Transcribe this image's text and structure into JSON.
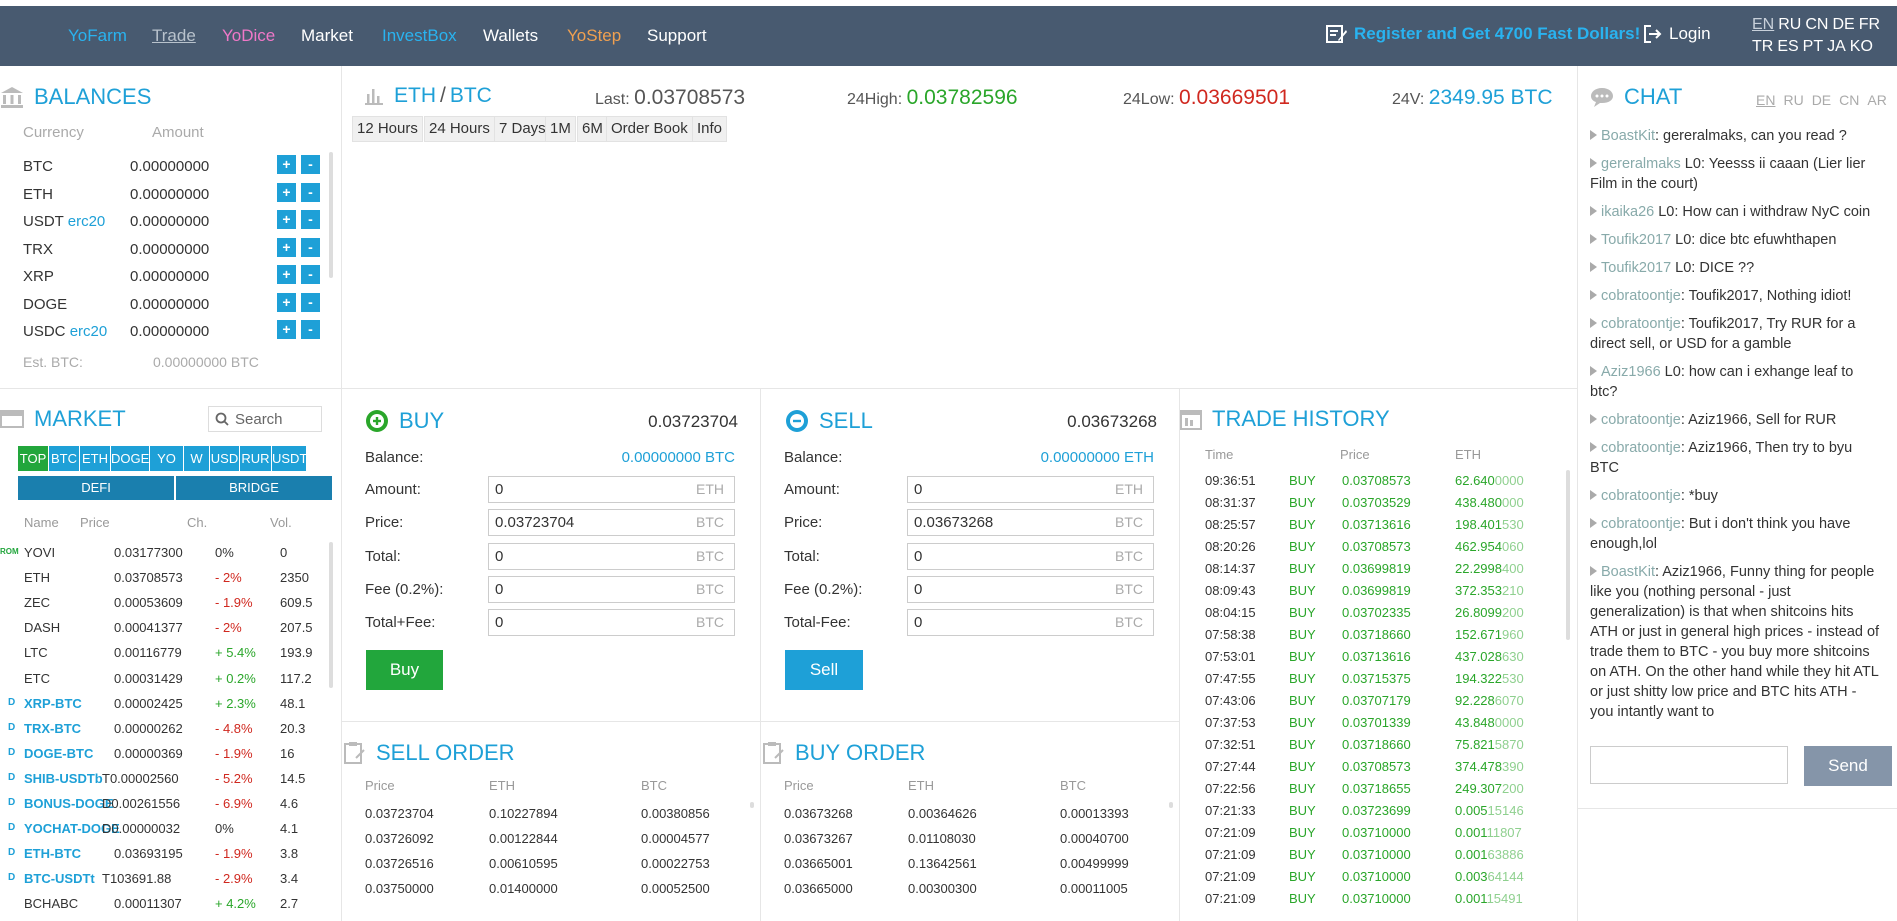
{
  "nav": {
    "items": [
      {
        "label": "YoFarm",
        "color": "#29b3f0"
      },
      {
        "label": "Trade",
        "color": "#b8c2cc"
      },
      {
        "label": "YoDice",
        "color": "#f078c8"
      },
      {
        "label": "Market",
        "color": "#ffffff"
      },
      {
        "label": "InvestBox",
        "color": "#29b3f0"
      },
      {
        "label": "Wallets",
        "color": "#ffffff"
      },
      {
        "label": "YoStep",
        "color": "#f0a050"
      },
      {
        "label": "Support",
        "color": "#ffffff"
      }
    ],
    "promo": "Register and Get 4700 Fast Dollars!",
    "login": "Login",
    "langs_row1": [
      "EN",
      "RU",
      "CN",
      "DE",
      "FR"
    ],
    "langs_row2": [
      "TR",
      "ES",
      "PT",
      "JA",
      "KO"
    ]
  },
  "balances": {
    "title": "BALANCES",
    "col_currency": "Currency",
    "col_amount": "Amount",
    "rows": [
      {
        "cur": "BTC",
        "tag": "",
        "amount": "0.00000000"
      },
      {
        "cur": "ETH",
        "tag": "",
        "amount": "0.00000000"
      },
      {
        "cur": "USDT",
        "tag": "erc20",
        "amount": "0.00000000"
      },
      {
        "cur": "TRX",
        "tag": "",
        "amount": "0.00000000"
      },
      {
        "cur": "XRP",
        "tag": "",
        "amount": "0.00000000"
      },
      {
        "cur": "DOGE",
        "tag": "",
        "amount": "0.00000000"
      },
      {
        "cur": "USDC",
        "tag": "erc20",
        "amount": "0.00000000"
      }
    ],
    "est_label": "Est. BTC:",
    "est_value": "0.00000000 BTC"
  },
  "market": {
    "title": "MARKET",
    "search_placeholder": "Search",
    "tabs": [
      "TOP",
      "BTC",
      "ETH",
      "DOGE",
      "YO",
      "W",
      "USD",
      "RUR",
      "USDT"
    ],
    "tabs2": [
      "DEFI",
      "BRIDGE"
    ],
    "cols": [
      "Name",
      "Price",
      "Ch.",
      "Vol."
    ],
    "rows": [
      {
        "prefix": "ROM",
        "name": "YOVI",
        "price": "0.03177300",
        "ch": "0%",
        "vol": "0",
        "dir": "flat",
        "link": false
      },
      {
        "prefix": "",
        "name": "ETH",
        "price": "0.03708573",
        "ch": "- 2%",
        "vol": "2350",
        "dir": "down",
        "link": false
      },
      {
        "prefix": "",
        "name": "ZEC",
        "price": "0.00053609",
        "ch": "- 1.9%",
        "vol": "609.5",
        "dir": "down",
        "link": false
      },
      {
        "prefix": "",
        "name": "DASH",
        "price": "0.00041377",
        "ch": "- 2%",
        "vol": "207.5",
        "dir": "down",
        "link": false
      },
      {
        "prefix": "",
        "name": "LTC",
        "price": "0.00116779",
        "ch": "+ 5.4%",
        "vol": "193.9",
        "dir": "up",
        "link": false
      },
      {
        "prefix": "",
        "name": "ETC",
        "price": "0.00031429",
        "ch": "+ 0.2%",
        "vol": "117.2",
        "dir": "up",
        "link": false
      },
      {
        "prefix": "D",
        "name": "XRP-BTC",
        "price": "0.00002425",
        "ch": "+ 2.3%",
        "vol": "48.1",
        "dir": "up",
        "link": true
      },
      {
        "prefix": "D",
        "name": "TRX-BTC",
        "price": "0.00000262",
        "ch": "- 4.8%",
        "vol": "20.3",
        "dir": "down",
        "link": true
      },
      {
        "prefix": "D",
        "name": "DOGE-BTC",
        "price": "0.00000369",
        "ch": "- 1.9%",
        "vol": "16",
        "dir": "down",
        "link": true
      },
      {
        "prefix": "D",
        "name": "SHIB-USDTb",
        "price": "T0.00002560",
        "ch": "- 5.2%",
        "vol": "14.5",
        "dir": "down",
        "link": true
      },
      {
        "prefix": "D",
        "name": "BONUS-DOGE",
        "price": "D0.00261556",
        "ch": "- 6.9%",
        "vol": "4.6",
        "dir": "down",
        "link": true
      },
      {
        "prefix": "D",
        "name": "YOCHAT-DOGE",
        "price": "D0.00000032",
        "ch": "0%",
        "vol": "4.1",
        "dir": "flat",
        "link": true
      },
      {
        "prefix": "D",
        "name": "ETH-BTC",
        "price": "0.03693195",
        "ch": "- 1.9%",
        "vol": "3.8",
        "dir": "down",
        "link": true
      },
      {
        "prefix": "D",
        "name": "BTC-USDTt",
        "price": "T103691.88",
        "ch": "- 2.9%",
        "vol": "3.4",
        "dir": "down",
        "link": true
      },
      {
        "prefix": "",
        "name": "BCHABC",
        "price": "0.00011307",
        "ch": "+ 4.2%",
        "vol": "2.7",
        "dir": "up",
        "link": false
      }
    ]
  },
  "ticker": {
    "base": "ETH",
    "sep": "/",
    "quote": "BTC",
    "last_label": "Last:",
    "last_value": "0.03708573",
    "high_label": "24High:",
    "high_value": "0.03782596",
    "low_label": "24Low:",
    "low_value": "0.03669501",
    "vol_label": "24V:",
    "vol_value": "2349.95 BTC",
    "timeframes": [
      "12 Hours",
      "24 Hours",
      "7 Days",
      "1M",
      "6M",
      "Order Book",
      "Info"
    ]
  },
  "buy": {
    "title": "BUY",
    "price_top": "0.03723704",
    "balance_label": "Balance:",
    "balance_value": "0.00000000 BTC",
    "amount_label": "Amount:",
    "amount_value": "0",
    "amount_unit": "ETH",
    "price_label": "Price:",
    "price_value": "0.03723704",
    "price_unit": "BTC",
    "total_label": "Total:",
    "total_value": "0",
    "total_unit": "BTC",
    "fee_label": "Fee (0.2%):",
    "fee_value": "0",
    "fee_unit": "BTC",
    "tf_label": "Total+Fee:",
    "tf_value": "0",
    "tf_unit": "BTC",
    "button": "Buy"
  },
  "sell": {
    "title": "SELL",
    "price_top": "0.03673268",
    "balance_label": "Balance:",
    "balance_value": "0.00000000 ETH",
    "amount_label": "Amount:",
    "amount_value": "0",
    "amount_unit": "ETH",
    "price_label": "Price:",
    "price_value": "0.03673268",
    "price_unit": "BTC",
    "total_label": "Total:",
    "total_value": "0",
    "total_unit": "BTC",
    "fee_label": "Fee (0.2%):",
    "fee_value": "0",
    "fee_unit": "BTC",
    "tf_label": "Total-Fee:",
    "tf_value": "0",
    "tf_unit": "BTC",
    "button": "Sell"
  },
  "sell_order": {
    "title": "SELL ORDER",
    "cols": [
      "Price",
      "ETH",
      "BTC"
    ],
    "rows": [
      [
        "0.03723704",
        "0.10227894",
        "0.00380856"
      ],
      [
        "0.03726092",
        "0.00122844",
        "0.00004577"
      ],
      [
        "0.03726516",
        "0.00610595",
        "0.00022753"
      ],
      [
        "0.03750000",
        "0.01400000",
        "0.00052500"
      ]
    ]
  },
  "buy_order": {
    "title": "BUY ORDER",
    "cols": [
      "Price",
      "ETH",
      "BTC"
    ],
    "rows": [
      [
        "0.03673268",
        "0.00364626",
        "0.00013393"
      ],
      [
        "0.03673267",
        "0.01108030",
        "0.00040700"
      ],
      [
        "0.03665001",
        "0.13642561",
        "0.00499999"
      ],
      [
        "0.03665000",
        "0.00300300",
        "0.00011005"
      ]
    ]
  },
  "history": {
    "title": "TRADE HISTORY",
    "cols": [
      "Time",
      "Price",
      "ETH"
    ],
    "rows": [
      {
        "time": "09:36:51",
        "type": "BUY",
        "price": "0.03708573",
        "eth_a": "62.640",
        "eth_b": "0000"
      },
      {
        "time": "08:31:37",
        "type": "BUY",
        "price": "0.03703529",
        "eth_a": "438.480",
        "eth_b": "000"
      },
      {
        "time": "08:25:57",
        "type": "BUY",
        "price": "0.03713616",
        "eth_a": "198.401",
        "eth_b": "530"
      },
      {
        "time": "08:20:26",
        "type": "BUY",
        "price": "0.03708573",
        "eth_a": "462.954",
        "eth_b": "060"
      },
      {
        "time": "08:14:37",
        "type": "BUY",
        "price": "0.03699819",
        "eth_a": "22.2998",
        "eth_b": "400"
      },
      {
        "time": "08:09:43",
        "type": "BUY",
        "price": "0.03699819",
        "eth_a": "372.353",
        "eth_b": "210"
      },
      {
        "time": "08:04:15",
        "type": "BUY",
        "price": "0.03702335",
        "eth_a": "26.8099",
        "eth_b": "200"
      },
      {
        "time": "07:58:38",
        "type": "BUY",
        "price": "0.03718660",
        "eth_a": "152.671",
        "eth_b": "960"
      },
      {
        "time": "07:53:01",
        "type": "BUY",
        "price": "0.03713616",
        "eth_a": "437.028",
        "eth_b": "630"
      },
      {
        "time": "07:47:55",
        "type": "BUY",
        "price": "0.03715375",
        "eth_a": "194.322",
        "eth_b": "530"
      },
      {
        "time": "07:43:06",
        "type": "BUY",
        "price": "0.03707179",
        "eth_a": "92.228",
        "eth_b": "6070"
      },
      {
        "time": "07:37:53",
        "type": "BUY",
        "price": "0.03701339",
        "eth_a": "43.848",
        "eth_b": "0000"
      },
      {
        "time": "07:32:51",
        "type": "BUY",
        "price": "0.03718660",
        "eth_a": "75.821",
        "eth_b": "5870"
      },
      {
        "time": "07:27:44",
        "type": "BUY",
        "price": "0.03708573",
        "eth_a": "374.478",
        "eth_b": "390"
      },
      {
        "time": "07:22:56",
        "type": "BUY",
        "price": "0.03718655",
        "eth_a": "249.307",
        "eth_b": "200"
      },
      {
        "time": "07:21:33",
        "type": "BUY",
        "price": "0.03723699",
        "eth_a": "0.005",
        "eth_b": "15146"
      },
      {
        "time": "07:21:09",
        "type": "BUY",
        "price": "0.03710000",
        "eth_a": "0.001",
        "eth_b": "11807"
      },
      {
        "time": "07:21:09",
        "type": "BUY",
        "price": "0.03710000",
        "eth_a": "0.001",
        "eth_b": "63886"
      },
      {
        "time": "07:21:09",
        "type": "BUY",
        "price": "0.03710000",
        "eth_a": "0.003",
        "eth_b": "64144"
      },
      {
        "time": "07:21:09",
        "type": "BUY",
        "price": "0.03710000",
        "eth_a": "0.001",
        "eth_b": "15491"
      }
    ]
  },
  "chat": {
    "title": "CHAT",
    "langs": [
      "EN",
      "RU",
      "DE",
      "CN",
      "AR"
    ],
    "messages": [
      {
        "user": "BoastKit",
        "text": ": gereralmaks, can you read ?"
      },
      {
        "user": "gereralmaks",
        "text": " L0: Yeesss ii caaan (Lier lier Film in the court)"
      },
      {
        "user": "ikaika26",
        "text": " L0: How can i withdraw NyC coin"
      },
      {
        "user": "Toufik2017",
        "text": " L0: dice btc efuwhthapen"
      },
      {
        "user": "Toufik2017",
        "text": " L0: DICE ??"
      },
      {
        "user": "cobratoontje",
        "text": ": Toufik2017, Nothing idiot!"
      },
      {
        "user": "cobratoontje",
        "text": ": Toufik2017, Try RUR for a direct sell, or USD for a gamble"
      },
      {
        "user": "Aziz1966",
        "text": " L0: how can i exhange leaf to btc?"
      },
      {
        "user": "cobratoontje",
        "text": ": Aziz1966, Sell for RUR"
      },
      {
        "user": "cobratoontje",
        "text": ": Aziz1966, Then try to byu BTC"
      },
      {
        "user": "cobratoontje",
        "text": ": *buy"
      },
      {
        "user": "cobratoontje",
        "text": ": But i don't think you have enough,lol"
      },
      {
        "user": "BoastKit",
        "text": ": Aziz1966, Funny thing for people like you (nothing personal - just generalization) is that when shitcoins hits ATH or just in general high prices - instead of trade them to BTC - you buy more shitcoins on ATH. On the other hand while they hit ATL or just shitty low price and BTC hits ATH - you intantly want to"
      }
    ],
    "input_placeholder": "",
    "send": "Send"
  }
}
